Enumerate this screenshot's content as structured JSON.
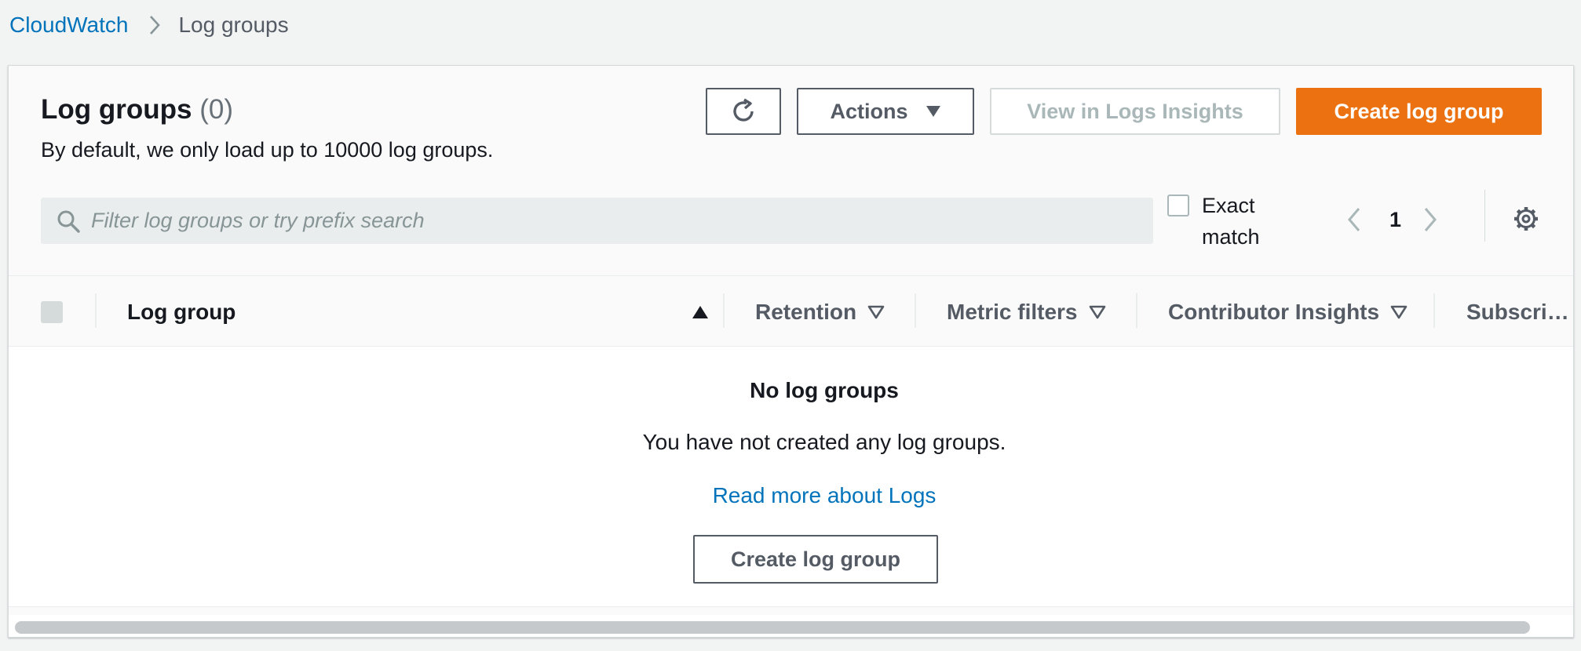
{
  "breadcrumb": {
    "root": "CloudWatch",
    "current": "Log groups"
  },
  "header": {
    "title": "Log groups",
    "count": "(0)",
    "subtitle": "By default, we only load up to 10000 log groups."
  },
  "toolbar": {
    "actions_label": "Actions",
    "view_insights_label": "View in Logs Insights",
    "create_label": "Create log group"
  },
  "search": {
    "placeholder": "Filter log groups or try prefix search",
    "value": ""
  },
  "filter": {
    "exact_match_label": "Exact match",
    "exact_match_checked": false
  },
  "pagination": {
    "current_page": "1"
  },
  "table": {
    "columns": [
      {
        "label": "Log group",
        "sort": "ascending"
      },
      {
        "label": "Retention",
        "sort": "none"
      },
      {
        "label": "Metric filters",
        "sort": "none"
      },
      {
        "label": "Contributor Insights",
        "sort": "none"
      },
      {
        "label": "Subscri…",
        "sort": "none"
      }
    ],
    "rows": []
  },
  "empty_state": {
    "title": "No log groups",
    "description": "You have not created any log groups.",
    "link": "Read more about Logs",
    "button": "Create log group"
  },
  "colors": {
    "primary": "#ec7211",
    "link": "#0073bb",
    "text": "#16191f",
    "muted": "#545b64",
    "disabled": "#aab7b8"
  },
  "icons": {
    "breadcrumb_separator": "chevron-right-icon",
    "refresh": "refresh-icon",
    "actions_caret": "caret-down-icon",
    "search": "search-icon",
    "prev_page": "chevron-left-icon",
    "next_page": "chevron-right-icon",
    "preferences": "gear-icon"
  }
}
